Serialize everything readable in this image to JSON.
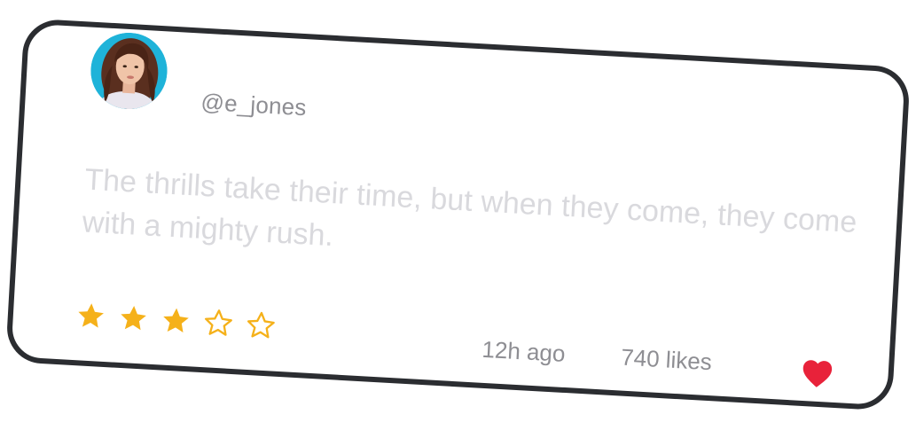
{
  "card": {
    "user": {
      "handle": "@e_jones",
      "avatar_icon": "user-photo-avatar"
    },
    "review": {
      "text": "The thrills take their time, but when they come, they come with a mighty rush."
    },
    "rating": {
      "value": 3,
      "max": 5,
      "filled_color": "#f5b11a",
      "empty_color": "#f5b11a"
    },
    "meta": {
      "time_ago": "12h ago",
      "likes": "740 likes"
    },
    "like_icon": "heart-icon",
    "like_color": "#e8223a",
    "border_color": "#2b2d31"
  }
}
